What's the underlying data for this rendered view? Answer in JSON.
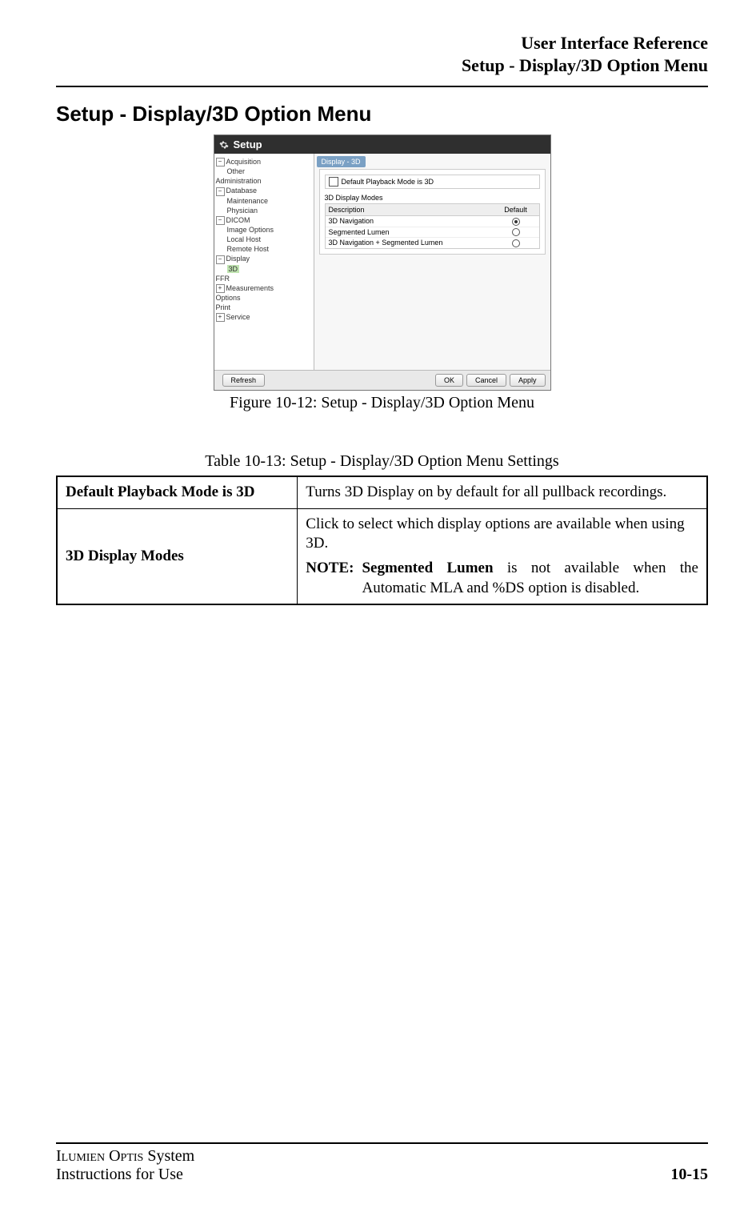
{
  "header": {
    "line1": "User Interface Reference",
    "line2": "Setup - Display/3D Option Menu"
  },
  "section_title": "Setup - Display/3D Option Menu",
  "screenshot": {
    "window_title": "Setup",
    "tree": [
      {
        "label": "Acquisition",
        "expander": "−",
        "indent": 0
      },
      {
        "label": "Other",
        "indent": 1
      },
      {
        "label": "Administration",
        "indent": 0
      },
      {
        "label": "Database",
        "expander": "−",
        "indent": 0
      },
      {
        "label": "Maintenance",
        "indent": 1
      },
      {
        "label": "Physician",
        "indent": 1
      },
      {
        "label": "DICOM",
        "expander": "−",
        "indent": 0
      },
      {
        "label": "Image Options",
        "indent": 1
      },
      {
        "label": "Local Host",
        "indent": 1
      },
      {
        "label": "Remote Host",
        "indent": 1
      },
      {
        "label": "Display",
        "expander": "−",
        "indent": 0
      },
      {
        "label": "3D",
        "indent": 1,
        "selected": true
      },
      {
        "label": "FFR",
        "indent": 0
      },
      {
        "label": "Measurements",
        "expander": "+",
        "indent": 0
      },
      {
        "label": "Options",
        "indent": 0
      },
      {
        "label": "Print",
        "indent": 0
      },
      {
        "label": "Service",
        "expander": "+",
        "indent": 0
      }
    ],
    "pane": {
      "tab_label": "Display - 3D",
      "checkbox_label": "Default Playback Mode is 3D",
      "modes_title": "3D Display Modes",
      "modes_header_desc": "Description",
      "modes_header_default": "Default",
      "modes": [
        {
          "desc": "3D Navigation",
          "default": true
        },
        {
          "desc": "Segmented Lumen",
          "default": false
        },
        {
          "desc": "3D Navigation + Segmented Lumen",
          "default": false
        }
      ]
    },
    "buttons": {
      "refresh": "Refresh",
      "ok": "OK",
      "cancel": "Cancel",
      "apply": "Apply"
    }
  },
  "figure_caption": "Figure 10-12:  Setup - Display/3D Option Menu",
  "table_caption": "Table 10-13:  Setup - Display/3D Option Menu Settings",
  "settings_table": {
    "rows": [
      {
        "label": "Default Playback Mode is 3D",
        "text": "Turns 3D Display on by default for all pullback recordings."
      },
      {
        "label": "3D Display Modes",
        "text": "Click to select which display options are available when using 3D.",
        "note_label": "NOTE:",
        "note_strong": "Segmented Lumen",
        "note_rest": " is not available when the Automatic MLA and %DS option is disabled."
      }
    ]
  },
  "footer": {
    "product_smallcaps_1": "Ilumien",
    "product_smallcaps_2": "Optis",
    "product_rest": " System",
    "line2": "Instructions for Use",
    "page": "10-15"
  }
}
